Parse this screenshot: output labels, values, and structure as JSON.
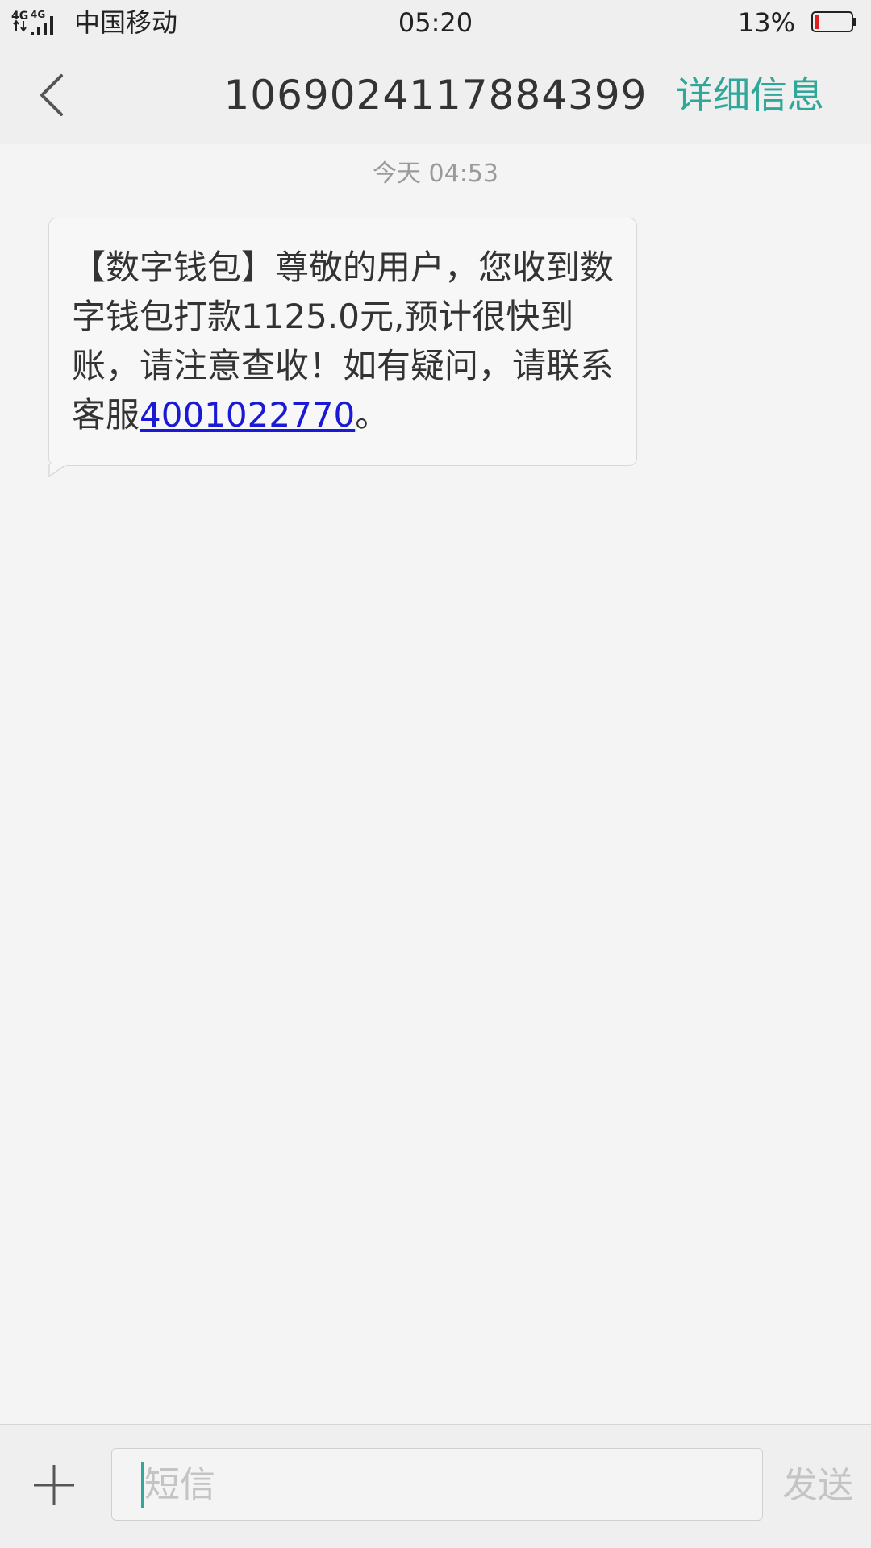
{
  "status_bar": {
    "network_1": "4G",
    "network_2": "4G",
    "carrier": "中国移动",
    "time": "05:20",
    "battery_percent": "13%",
    "battery_level": 0.13,
    "battery_color": "#e02020"
  },
  "header": {
    "title": "1069024117884399",
    "detail_label": "详细信息",
    "accent_color": "#2fa89a",
    "back_icon": "chevron-left-icon"
  },
  "conversation": {
    "timestamp": "今天  04:53",
    "messages": [
      {
        "text_before_link": "【数字钱包】尊敬的用户，您收到数字钱包打款1125.0元,预计很快到账，请注意查收！如有疑问，请联系客服",
        "link": "4001022770",
        "text_after_link": "。"
      }
    ]
  },
  "composer": {
    "add_icon": "plus-icon",
    "placeholder": "短信",
    "value": "",
    "send_label": "发送"
  }
}
